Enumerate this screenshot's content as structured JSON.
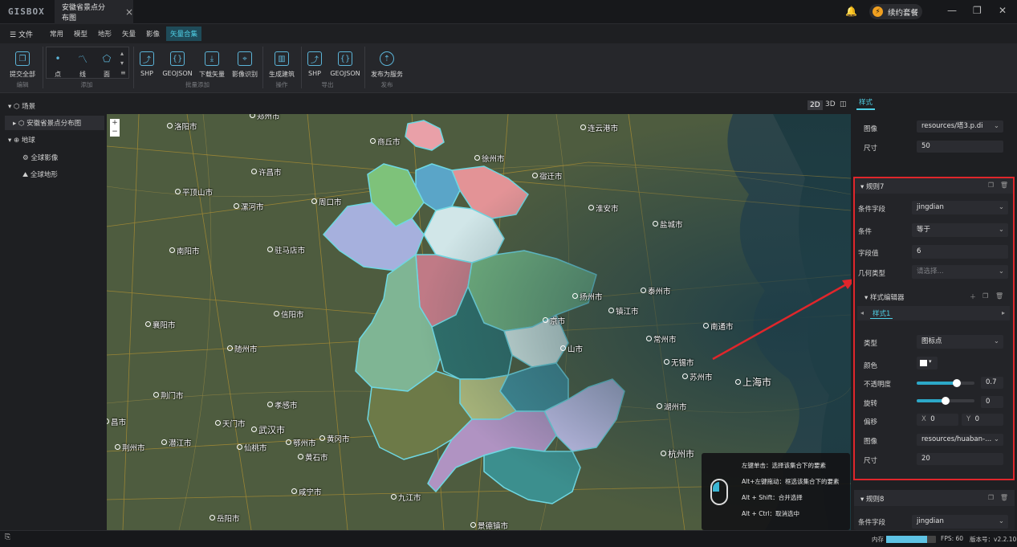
{
  "window": {
    "logo": "GISBOX",
    "tab_title": "安徽省景点分布图",
    "renew_label": "续约套餐"
  },
  "menubar": {
    "file": "文件",
    "tabs": [
      "常用",
      "模型",
      "地形",
      "矢量",
      "影像",
      "矢量合集"
    ],
    "active_tab": "矢量合集"
  },
  "toolbar": {
    "submit_all": "提交全部",
    "edit_group": "编辑",
    "draw_point": "点",
    "draw_line": "线",
    "draw_polygon": "面",
    "add_group": "添加",
    "batch": [
      "SHP",
      "GEOJSON",
      "下载矢量",
      "影像识别"
    ],
    "batch_group": "批量添加",
    "build": "生成建筑",
    "op_group": "操作",
    "export": [
      "SHP",
      "GEOJSON"
    ],
    "export_group": "导出",
    "publish": "发布为服务",
    "publish_group": "发布"
  },
  "scene_tree": {
    "scene": "场景",
    "layer": "安徽省景点分布图",
    "earth": "地球",
    "imagery": "全球影像",
    "terrain": "全球地形"
  },
  "view_modes": [
    "2D",
    "3D"
  ],
  "map": {
    "cities": [
      {
        "name": "郑州市"
      },
      {
        "name": "洛阳市"
      },
      {
        "name": "商丘市"
      },
      {
        "name": "徐州市"
      },
      {
        "name": "连云港市"
      },
      {
        "name": "许昌市"
      },
      {
        "name": "宿迁市"
      },
      {
        "name": "平顶山市"
      },
      {
        "name": "周口市"
      },
      {
        "name": "漯河市"
      },
      {
        "name": "淮安市"
      },
      {
        "name": "盐城市"
      },
      {
        "name": "南阳市"
      },
      {
        "name": "驻马店市"
      },
      {
        "name": "泰州市"
      },
      {
        "name": "扬州市"
      },
      {
        "name": "镇江市"
      },
      {
        "name": "信阳市"
      },
      {
        "name": "京市"
      },
      {
        "name": "常州市"
      },
      {
        "name": "南通市"
      },
      {
        "name": "襄阳市"
      },
      {
        "name": "随州市"
      },
      {
        "name": "无锡市"
      },
      {
        "name": "苏州市"
      },
      {
        "name": "上海市"
      },
      {
        "name": "荆门市"
      },
      {
        "name": "孝感市"
      },
      {
        "name": "湖州市"
      },
      {
        "name": "天门市"
      },
      {
        "name": "武汉市"
      },
      {
        "name": "黄冈市"
      },
      {
        "name": "荆州市"
      },
      {
        "name": "潜江市"
      },
      {
        "name": "仙桃市"
      },
      {
        "name": "鄂州市"
      },
      {
        "name": "黄石市"
      },
      {
        "name": "杭州市"
      },
      {
        "name": "咸宁市"
      },
      {
        "name": "九江市"
      },
      {
        "name": "岳阳市"
      },
      {
        "name": "景德镇市"
      },
      {
        "name": "昌市"
      },
      {
        "name": "山市"
      }
    ],
    "legend": [
      "左键单击：选择该集合下的要素",
      "Alt+左键拖动：框选该集合下的要素",
      "Alt + Shift：合并选择",
      "Alt + Ctrl：取消选中"
    ]
  },
  "panel": {
    "tab": "样式",
    "top": {
      "image_label": "图像",
      "image_value": "resources/塔3.p.di",
      "size_label": "尺寸",
      "size_value": "50"
    },
    "rule7": {
      "title": "规则7",
      "field_label": "条件字段",
      "field_value": "jingdian",
      "cond_label": "条件",
      "cond_value": "等于",
      "val_label": "字段值",
      "val_value": "6",
      "geom_label": "几何类型",
      "geom_placeholder": "请选择...",
      "editor_title": "样式编辑器",
      "style_tab": "样式1",
      "type_label": "类型",
      "type_value": "图标点",
      "color_label": "颜色",
      "opacity_label": "不透明度",
      "opacity": 0.7,
      "opacity_text": "0.7",
      "rotate_label": "旋转",
      "rotate": 0,
      "rotate_text": "0",
      "offset_label": "偏移",
      "offset_x": "0",
      "offset_y": "0",
      "image_label": "图像",
      "image_value": "resources/huaban-...",
      "size_label": "尺寸",
      "size_value": "20"
    },
    "rule8": {
      "title": "规则8",
      "field_label": "条件字段",
      "field_value": "jingdian"
    }
  },
  "status": {
    "mem_label": "内存",
    "mem_fraction": 0.82,
    "fps": "FPS: 60",
    "version": "版本号：v2.2.10"
  },
  "colors": {
    "accent": "#4fd0e6",
    "highlight": "#e0262b"
  }
}
